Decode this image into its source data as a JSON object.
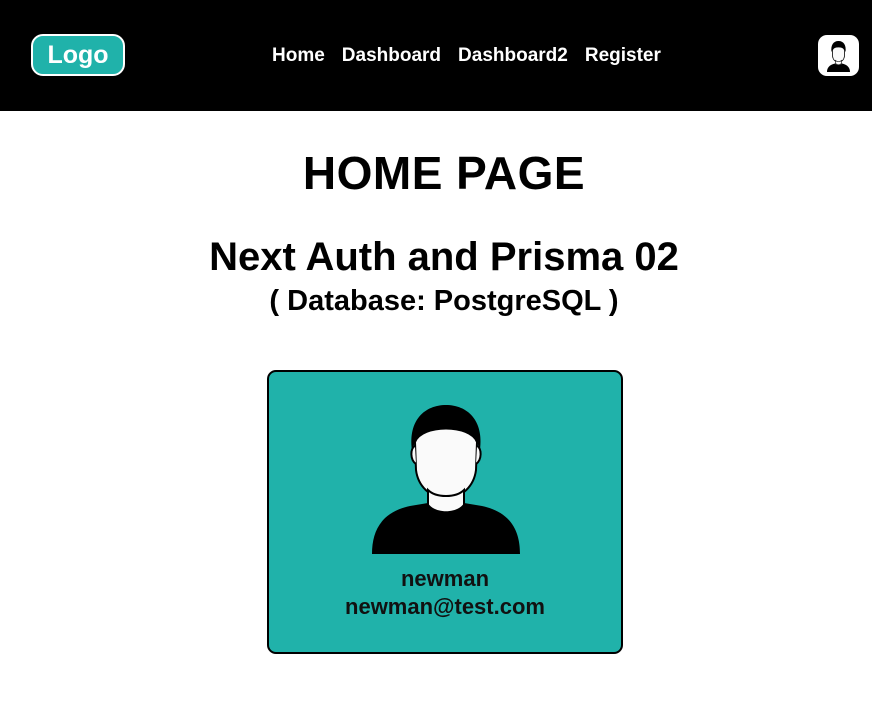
{
  "navbar": {
    "logo_label": "Logo",
    "links": [
      {
        "label": "Home"
      },
      {
        "label": "Dashboard"
      },
      {
        "label": "Dashboard2"
      },
      {
        "label": "Register"
      }
    ],
    "user_icon": "user-avatar-icon"
  },
  "main": {
    "title": "HOME PAGE",
    "subtitle": "Next Auth and Prisma 02",
    "database_label": "( Database: PostgreSQL )"
  },
  "profile": {
    "avatar_icon": "user-avatar-icon",
    "name": "newman",
    "email": "newman@test.com"
  },
  "colors": {
    "navbar_bg": "#000000",
    "accent": "#20b2aa",
    "text": "#000000"
  }
}
